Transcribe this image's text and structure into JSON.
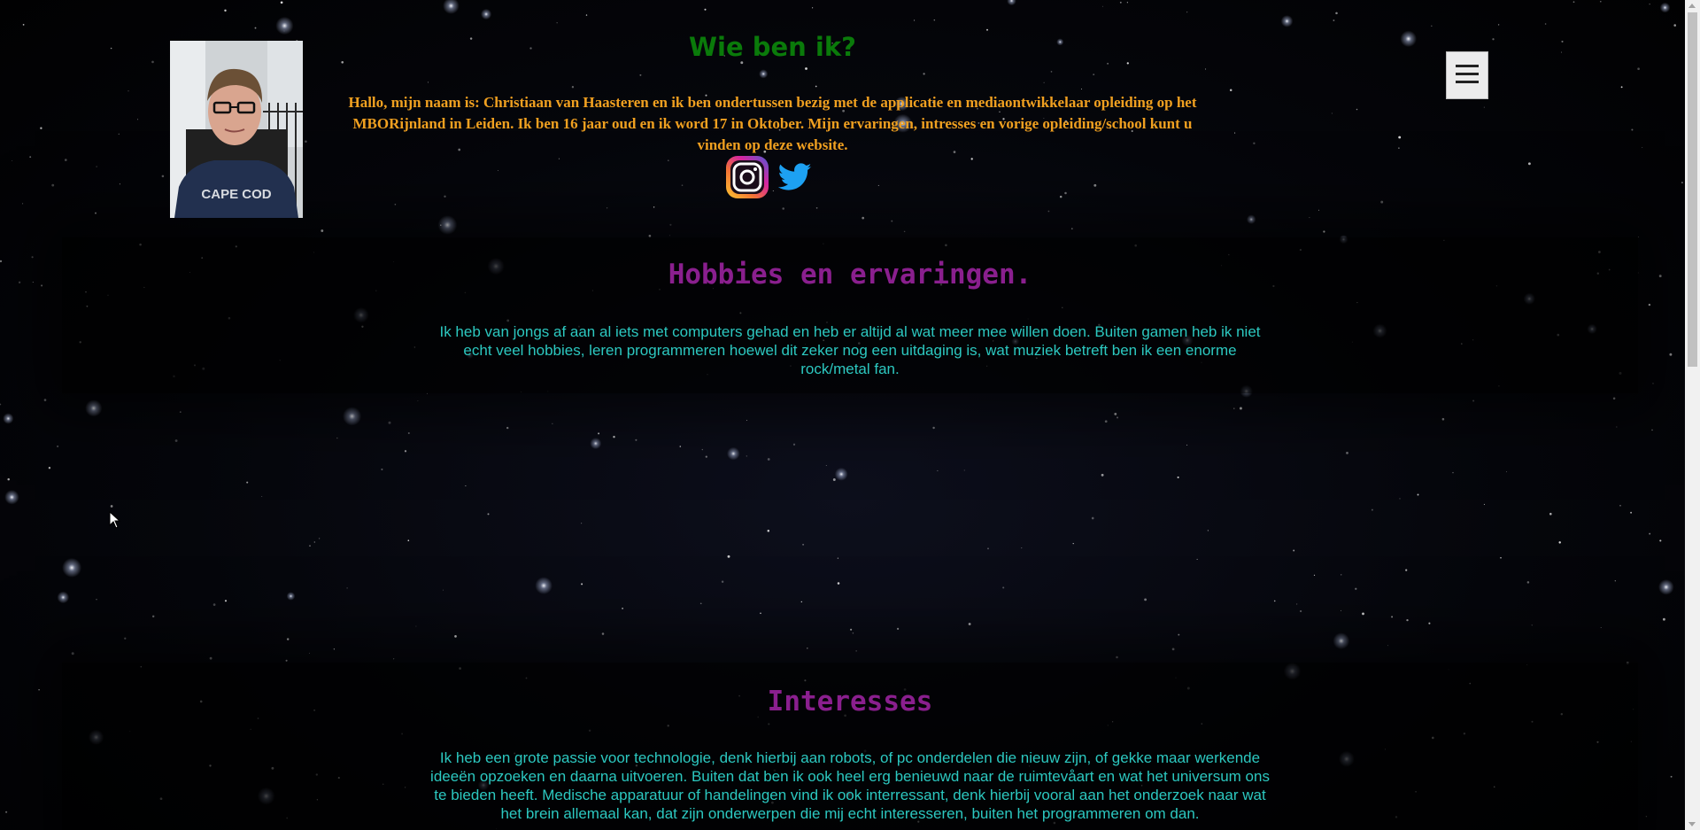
{
  "header": {
    "title": "Wie ben ik?",
    "intro": "Hallo, mijn naam is: Christiaan van Haasteren en ik ben ondertussen bezig met de applicatie en mediaontwikkelaar opleiding op het MBORijnland in Leiden. Ik ben 16 jaar oud en ik word 17 in Oktober. Mijn ervaringen, intresses en vorige opleiding/school kunt u vinden op deze website.",
    "photo_shirt_text": "CAPE COD",
    "social": [
      {
        "name": "instagram",
        "icon": "instagram-icon"
      },
      {
        "name": "twitter",
        "icon": "twitter-icon"
      }
    ]
  },
  "menu": {
    "icon": "hamburger-menu-icon",
    "glyph": "☰"
  },
  "sections": {
    "hobbies": {
      "title": "Hobbies en ervaringen.",
      "text": "Ik heb van jongs af aan al iets met computers gehad en heb er altijd al wat meer mee willen doen. Buiten gamen heb ik niet echt veel hobbies, leren programmeren hoewel dit zeker nog een uitdaging is, wat muziek betreft ben ik een enorme rock/metal fan."
    },
    "interests": {
      "title": "Interesses",
      "text": "Ik heb een grote passie voor technologie, denk hierbij aan robots, of pc onderdelen die nieuw zijn, of gekke maar werkende ideeën opzoeken en daarna uitvoeren. Buiten dat ben ik ook heel erg benieuwd naar de ruimtevåart en wat het universum ons te bieden heeft. Medische apparatuur of handelingen vind ik ook interressant, denk hierbij vooral aan het onderzoek naar wat het brein allemaal kan, dat zijn onderwerpen die mij echt interesseren, buiten het programmeren om dan."
    }
  },
  "colors": {
    "title_green": "#0a7a0a",
    "intro_orange": "#f0a020",
    "section_title_purple": "#8a1f8e",
    "section_text_teal": "#2cc8c0",
    "background": "#020204"
  }
}
